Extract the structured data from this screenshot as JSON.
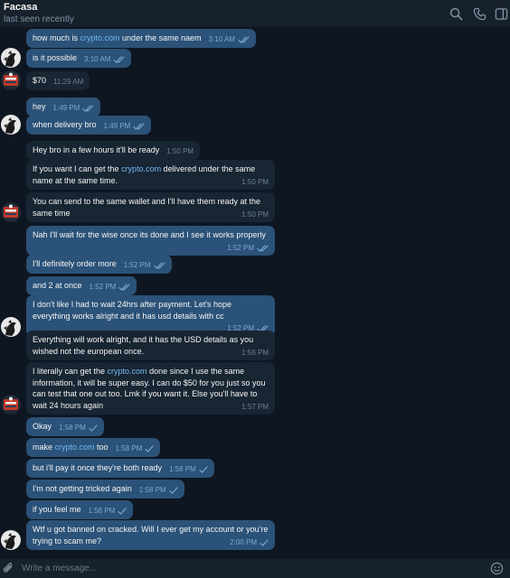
{
  "header": {
    "title": "Facasa",
    "status": "last seen recently",
    "icons": [
      "search-icon",
      "phone-icon",
      "sidebar-toggle-icon"
    ]
  },
  "input": {
    "placeholder": "Write a message...",
    "icons": [
      "attach-icon",
      "emoji-icon"
    ]
  },
  "colors": {
    "background": "#0e1621",
    "header": "#17212b",
    "outgoing_bubble": "#2b5278",
    "incoming_bubble": "#182533",
    "link": "#71baf2",
    "time_outgoing": "#7da8d3",
    "time_incoming": "#6d7f8f"
  },
  "messages": [
    {
      "dir": "out",
      "pre": "how much is ",
      "link": "crypto.com",
      "post": " under the same naem",
      "time": "3:10 AM",
      "ticks": "double"
    },
    {
      "dir": "out",
      "pre": "is it possible",
      "link": "",
      "post": "",
      "time": "3:10 AM",
      "ticks": "double"
    },
    {
      "dir": "in",
      "pre": "$70",
      "link": "",
      "post": "",
      "time": "11:29 AM",
      "ticks": ""
    },
    {
      "dir": "out",
      "pre": "hey",
      "link": "",
      "post": "",
      "time": "1:49 PM",
      "ticks": "double"
    },
    {
      "dir": "out",
      "pre": "when delivery bro",
      "link": "",
      "post": "",
      "time": "1:49 PM",
      "ticks": "double"
    },
    {
      "dir": "in",
      "pre": "Hey bro in a few hours it'll be ready",
      "link": "",
      "post": "",
      "time": "1:50 PM",
      "ticks": ""
    },
    {
      "dir": "in",
      "pre": "If you want I can get the ",
      "link": "crypto.com",
      "post": " delivered under the same name at the same time.",
      "time": "1:50 PM",
      "ticks": ""
    },
    {
      "dir": "in",
      "pre": "You can send to the same wallet and I'll have them ready at the same time",
      "link": "",
      "post": "",
      "time": "1:50 PM",
      "ticks": ""
    },
    {
      "dir": "out",
      "pre": "Nah I'll wait for the wise once its done and I see it works properly",
      "link": "",
      "post": "",
      "time": "1:52 PM",
      "ticks": "double"
    },
    {
      "dir": "out",
      "pre": "I'll definitely order more",
      "link": "",
      "post": "",
      "time": "1:52 PM",
      "ticks": "double"
    },
    {
      "dir": "out",
      "pre": "and 2 at once",
      "link": "",
      "post": "",
      "time": "1:52 PM",
      "ticks": "double"
    },
    {
      "dir": "out",
      "pre": "I don't like I had to wait 24hrs after payment. Let's hope everything works alright and it has usd details with cc",
      "link": "",
      "post": "",
      "time": "1:52 PM",
      "ticks": "double"
    },
    {
      "dir": "in",
      "pre": "Everything will work alright, and it has the USD details as you wished not the european once.",
      "link": "",
      "post": "",
      "time": "1:56 PM",
      "ticks": ""
    },
    {
      "dir": "in",
      "pre": "I literally can get the ",
      "link": "crypto.com",
      "post": " done since I use the same information, it will be super easy. I can do $50 for you just so you can test that one out too. Lmk if you want it. Else you'll have to wait 24 hours again",
      "time": "1:57 PM",
      "ticks": ""
    },
    {
      "dir": "out",
      "pre": "Okay",
      "link": "",
      "post": "",
      "time": "1:58 PM",
      "ticks": "single"
    },
    {
      "dir": "out",
      "pre": "make ",
      "link": "crypto.com",
      "post": " too",
      "time": "1:58 PM",
      "ticks": "single"
    },
    {
      "dir": "out",
      "pre": "but i'll pay it once they're both ready",
      "link": "",
      "post": "",
      "time": "1:58 PM",
      "ticks": "single"
    },
    {
      "dir": "out",
      "pre": "I'm not getting tricked again",
      "link": "",
      "post": "",
      "time": "1:58 PM",
      "ticks": "single"
    },
    {
      "dir": "out",
      "pre": "if you feel me",
      "link": "",
      "post": "",
      "time": "1:58 PM",
      "ticks": "single"
    },
    {
      "dir": "out",
      "pre": "Wtf u got banned on cracked. Will I ever get my account or you're trying to scam me?",
      "link": "",
      "post": "",
      "time": "2:00 PM",
      "ticks": "single"
    }
  ]
}
